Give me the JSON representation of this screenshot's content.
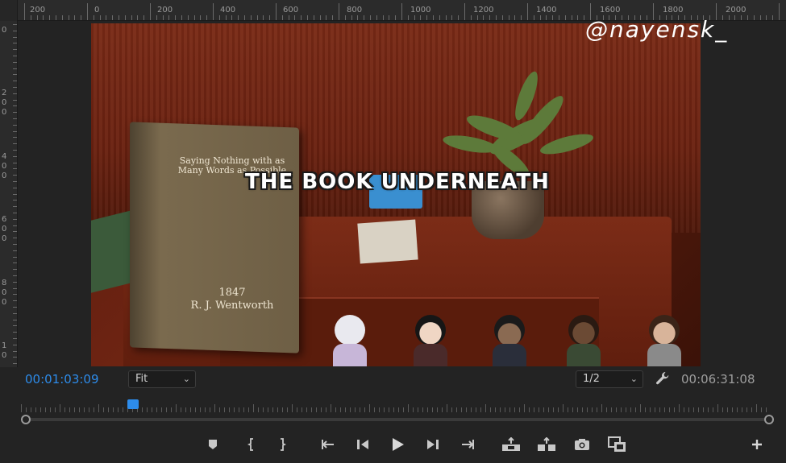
{
  "ruler": {
    "top_labels": [
      "200",
      "0",
      "200",
      "400",
      "600",
      "800",
      "1000",
      "1200",
      "1400",
      "1600",
      "1800",
      "2000"
    ],
    "left_labels": [
      "0",
      "2",
      "0",
      "0",
      "4",
      "0",
      "0",
      "6",
      "0",
      "0",
      "8",
      "0",
      "0",
      "1",
      "0"
    ]
  },
  "video": {
    "book_title": "Saying Nothing with as Many Words as Possible",
    "book_year": "1847",
    "book_author": "R. J. Wentworth",
    "caption": "THE BOOK UNDERNEATH",
    "watermark": "@nayensk_"
  },
  "controls": {
    "current_time": "00:01:03:09",
    "zoom_value": "Fit",
    "resolution_value": "1/2",
    "total_time": "00:06:31:08"
  },
  "playback": {
    "playhead_fraction": 0.15
  },
  "colors": {
    "accent": "#2d8ceb",
    "background": "#232323"
  },
  "icons": {
    "settings": "wrench-icon",
    "transport": [
      "marker-icon",
      "mark-in-icon",
      "mark-out-icon",
      "go-to-in-icon",
      "step-back-icon",
      "play-icon",
      "step-forward-icon",
      "go-to-out-icon",
      "lift-icon",
      "extract-icon",
      "export-frame-icon",
      "comparison-view-icon",
      "add-button-icon"
    ]
  }
}
